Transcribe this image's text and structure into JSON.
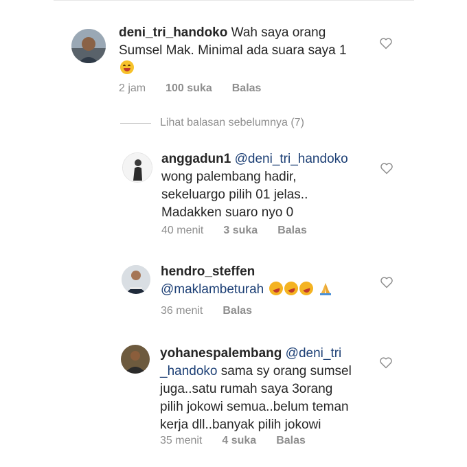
{
  "comments": [
    {
      "username": "deni_tri_handoko",
      "text": "Wah saya orang Sumsel Mak. Minimal ada suara saya 1",
      "line1": "Wah saya orang",
      "line2": "Sumsel Mak. Minimal ada suara saya 1",
      "time": "2 jam",
      "likes": "100 suka",
      "reply": "Balas",
      "emoji": "smiling-face-icon"
    },
    {
      "username": "anggadun1",
      "mention": "@deni_tri_handoko",
      "line2": "wong palembang hadir,",
      "line3": "sekeluargo pilih 01 jelas..",
      "line4": "Madakken suaro nyo 0",
      "time": "40 menit",
      "likes": "3 suka",
      "reply": "Balas"
    },
    {
      "username": "hendro_steffen",
      "mention": "@maklambeturah",
      "time": "36 menit",
      "reply": "Balas",
      "emojis": [
        "rolling-laughing-icon",
        "rolling-laughing-icon",
        "rolling-laughing-icon",
        "praying-hands-icon"
      ]
    },
    {
      "username": "yohanespalembang",
      "mention_part1": "@deni_tri",
      "mention_part2": "_handoko",
      "line2_rest": " sama sy orang sumsel",
      "line3": "juga..satu rumah saya 3orang",
      "line4": "pilih jokowi semua..belum teman",
      "line5": "kerja dll..banyak pilih jokowi",
      "time": "35 menit",
      "likes": "4 suka",
      "reply": "Balas"
    }
  ],
  "view_previous": "Lihat balasan sebelumnya (7)",
  "colors": {
    "mention": "#1c3f75",
    "meta": "#8e8e8e",
    "text": "#262626"
  }
}
